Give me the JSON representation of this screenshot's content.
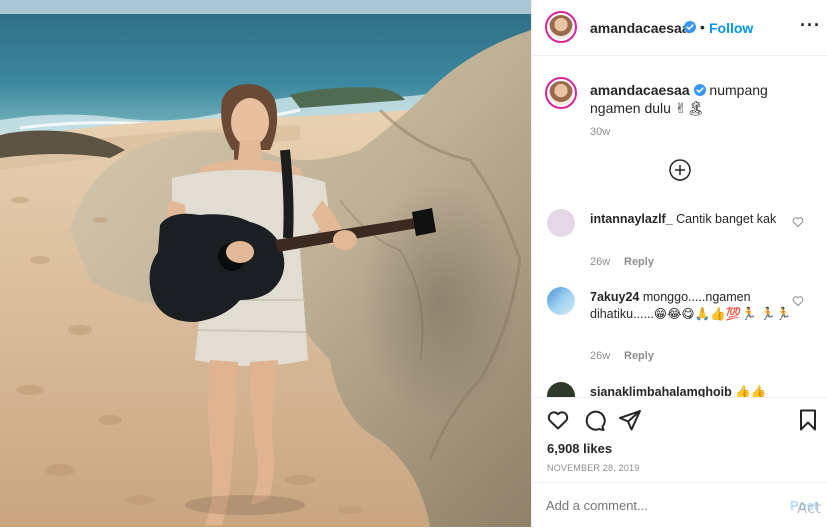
{
  "post": {
    "username": "amandacaesaa",
    "follow_label": "Follow",
    "separator": "•",
    "more_label": "···",
    "caption": "numpang ngamen dulu ✌🏝",
    "caption_age": "30w",
    "likes": "6,908 likes",
    "date": "NOVEMBER 28, 2019",
    "add_comment_placeholder": "Add a comment...",
    "post_label": "Post",
    "watermark": "Act"
  },
  "comments": [
    {
      "username": "intannaylazlf_",
      "text": "Cantik banget kak",
      "age": "26w",
      "reply_label": "Reply"
    },
    {
      "username": "7akuy24",
      "text": "monggo.....ngamen dihatiku......😁😂😋🙏👍💯🏃 🏃🏃",
      "age": "26w",
      "reply_label": "Reply"
    },
    {
      "username": "sianaklimbahalamghoib",
      "text": "👍👍"
    }
  ],
  "icons": [
    "verified-icon",
    "more-icon",
    "load-more-comments-icon",
    "comment-like-icon",
    "like-icon",
    "comment-icon",
    "share-icon",
    "save-icon"
  ],
  "colors": {
    "follow": "#0095f6",
    "muted": "#8e8e8e",
    "border": "#efefef",
    "post_disabled": "#b2dffc",
    "verified": "#3897f0"
  }
}
